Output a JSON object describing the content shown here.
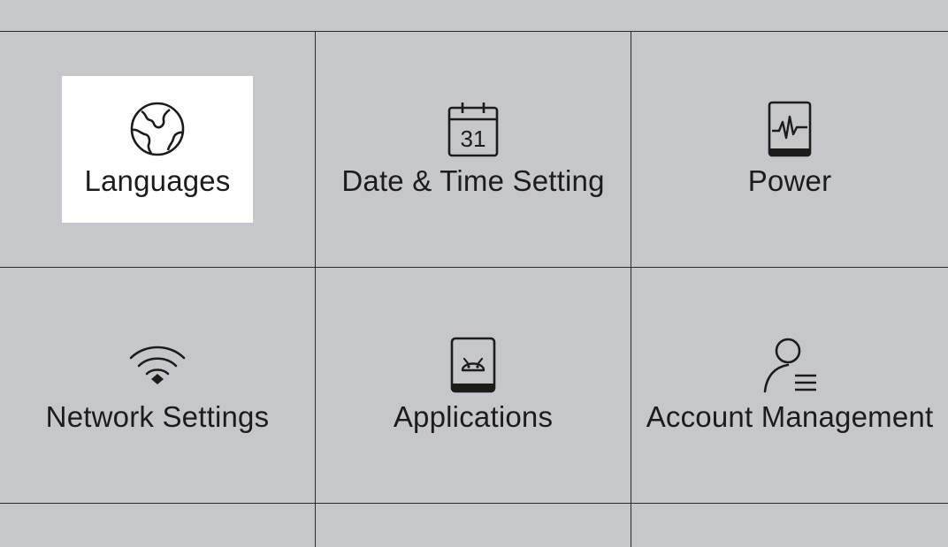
{
  "settings": {
    "items": [
      {
        "label": "Languages",
        "icon": "globe-icon",
        "selected": true
      },
      {
        "label": "Date & Time Setting",
        "icon": "calendar-icon",
        "calendar_day": "31"
      },
      {
        "label": "Power",
        "icon": "power-activity-icon"
      },
      {
        "label": "Network Settings",
        "icon": "wifi-icon"
      },
      {
        "label": "Applications",
        "icon": "android-icon"
      },
      {
        "label": "Account Management",
        "icon": "account-icon"
      }
    ]
  },
  "colors": {
    "background": "#c6c7cb",
    "selected_tile": "#ffffff",
    "grid_lines": "#2a2a2a",
    "text": "#1c1c1c"
  }
}
